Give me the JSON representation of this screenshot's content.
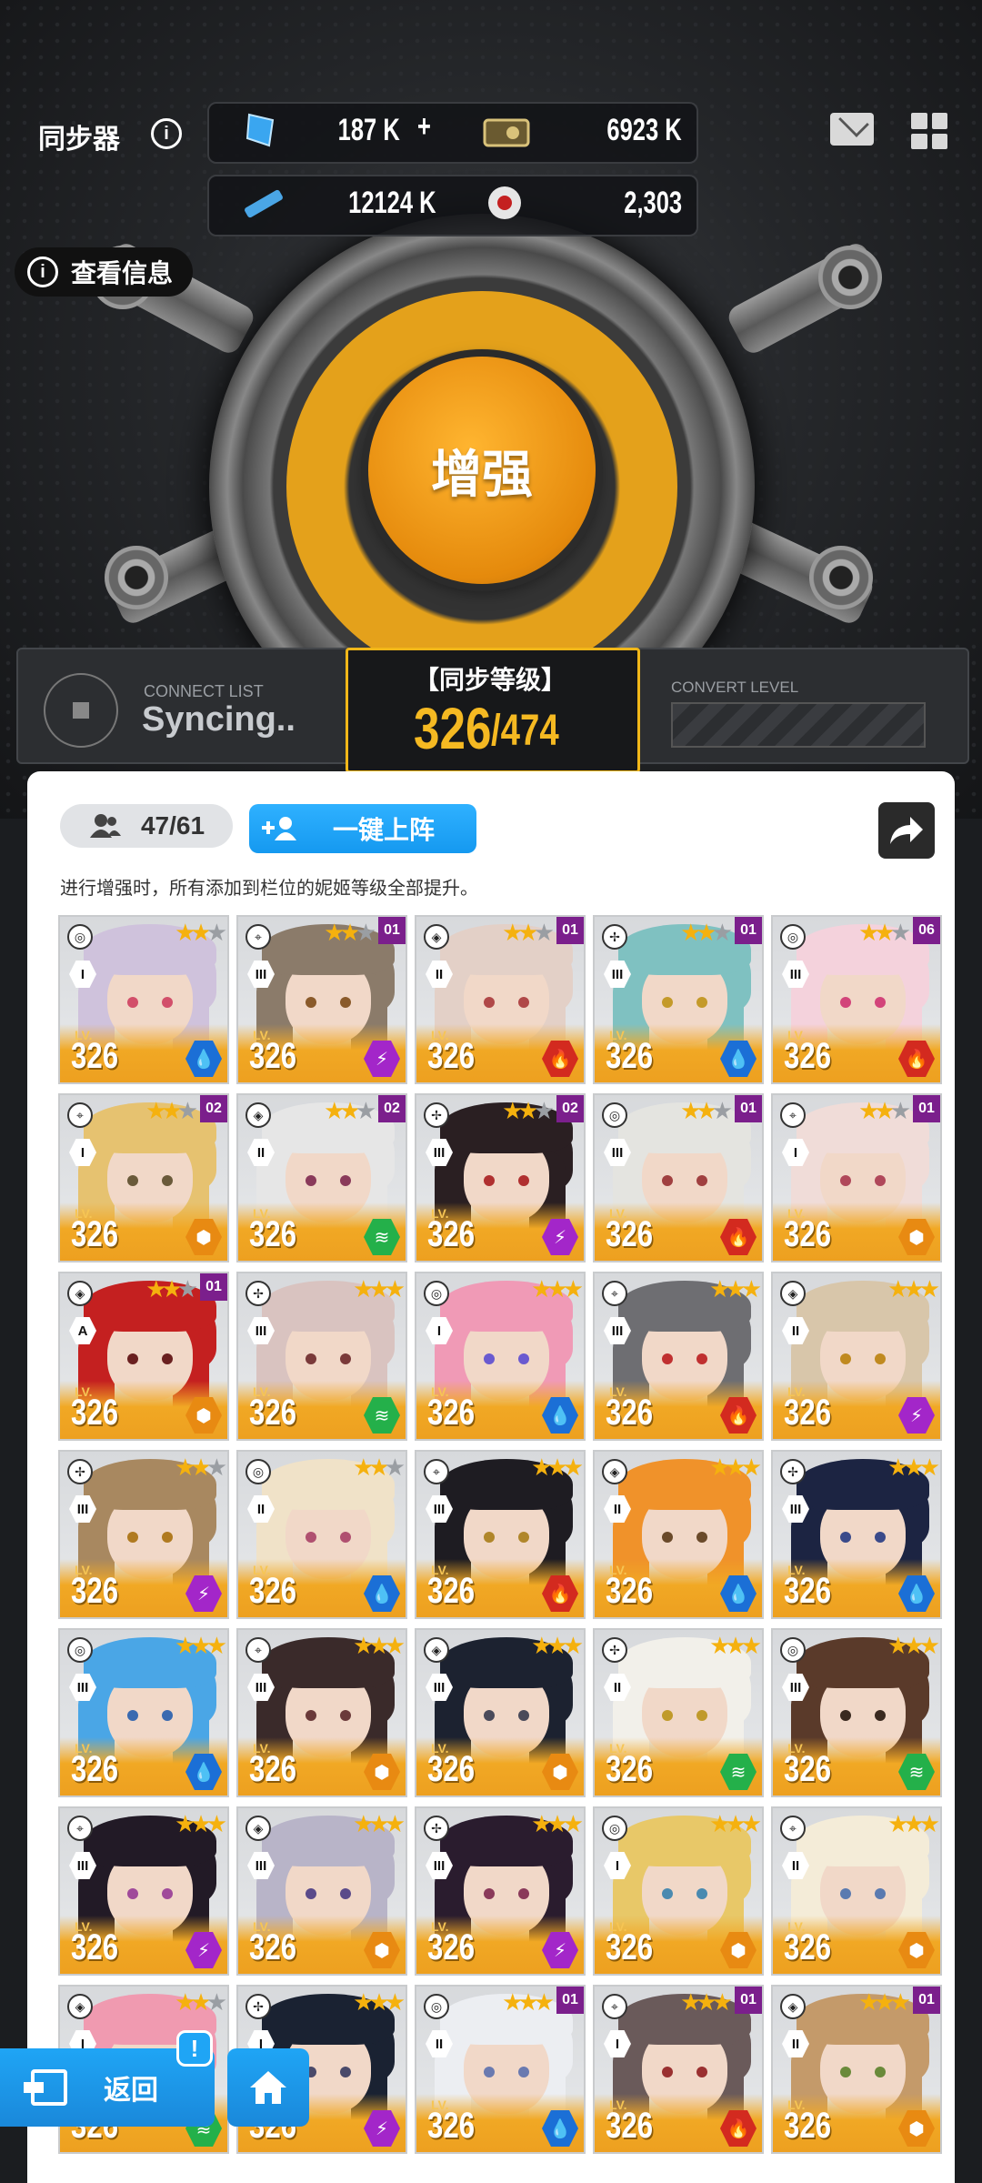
{
  "header": {
    "title": "同步器",
    "info_glyph": "i",
    "view_info_label": "查看信息"
  },
  "resources": {
    "gems": "187 K",
    "plus": "+",
    "credits": "6923 K",
    "battle_data": "12124 K",
    "core_dust": "2,303"
  },
  "enhance_label": "增强",
  "status": {
    "connect_label": "CONNECT LIST",
    "syncing": "Syncing..",
    "level_title": "【同步等级】",
    "level_current": "326",
    "level_max": "/474",
    "convert_label": "CONVERT LEVEL"
  },
  "panel": {
    "count": "47/61",
    "deploy_label": "一键上阵",
    "hint": "进行增强时，所有添加到栏位的妮姬等级全部提升。",
    "lv_text": "LV."
  },
  "nav": {
    "back_label": "返回",
    "alert": "!"
  },
  "colors": {
    "accent_orange": "#f1a824",
    "accent_blue": "#1fa5f5",
    "core_purple": "#7b1f8c",
    "water": "#1b6fd6",
    "fire": "#d32a1f",
    "electric": "#a326c9",
    "iron": "#e88a12",
    "wind": "#24b04a"
  },
  "cards": [
    {
      "level": "326",
      "burst": "I",
      "stars": "★★",
      "core": "",
      "elem": "water",
      "hair": "#cfc2dc",
      "eye": "#d24f6a"
    },
    {
      "level": "326",
      "burst": "III",
      "stars": "★★",
      "core": "01",
      "elem": "electric",
      "hair": "#8b7b6a",
      "eye": "#8a5a2a"
    },
    {
      "level": "326",
      "burst": "II",
      "stars": "★★",
      "core": "01",
      "elem": "fire",
      "hair": "#e3d0c7",
      "eye": "#b04848"
    },
    {
      "level": "326",
      "burst": "III",
      "stars": "★★",
      "core": "01",
      "elem": "water",
      "hair": "#7fc1c1",
      "eye": "#c49a2a"
    },
    {
      "level": "326",
      "burst": "III",
      "stars": "★★",
      "core": "06",
      "elem": "fire",
      "hair": "#f4d2dc",
      "eye": "#d2447a"
    },
    {
      "level": "326",
      "burst": "I",
      "stars": "★★",
      "core": "02",
      "elem": "iron",
      "hair": "#e6c270",
      "eye": "#6a5a3a"
    },
    {
      "level": "326",
      "burst": "II",
      "stars": "★★",
      "core": "02",
      "elem": "wind",
      "hair": "#e6e6e6",
      "eye": "#8a3a5a"
    },
    {
      "level": "326",
      "burst": "III",
      "stars": "★★",
      "core": "02",
      "elem": "electric",
      "hair": "#2a1f22",
      "eye": "#b03030"
    },
    {
      "level": "326",
      "burst": "III",
      "stars": "★★",
      "core": "01",
      "elem": "fire",
      "hair": "#e4e4e0",
      "eye": "#a04040"
    },
    {
      "level": "326",
      "burst": "I",
      "stars": "★★",
      "core": "01",
      "elem": "iron",
      "hair": "#f0dcd8",
      "eye": "#b0485a"
    },
    {
      "level": "326",
      "burst": "A",
      "stars": "★★",
      "core": "01",
      "elem": "iron",
      "hair": "#c42020",
      "eye": "#6a2020"
    },
    {
      "level": "326",
      "burst": "III",
      "stars": "★★★",
      "core": "",
      "elem": "wind",
      "hair": "#d9c3c0",
      "eye": "#7a3a3a"
    },
    {
      "level": "326",
      "burst": "I",
      "stars": "★★★",
      "core": "",
      "elem": "water",
      "hair": "#f09ab6",
      "eye": "#6a5ad0"
    },
    {
      "level": "326",
      "burst": "III",
      "stars": "★★★",
      "core": "",
      "elem": "fire",
      "hair": "#6e6e72",
      "eye": "#c03030"
    },
    {
      "level": "326",
      "burst": "II",
      "stars": "★★★",
      "core": "",
      "elem": "electric",
      "hair": "#d8c6aa",
      "eye": "#c08a20"
    },
    {
      "level": "326",
      "burst": "III",
      "stars": "★★",
      "core": "",
      "elem": "electric",
      "hair": "#a88860",
      "eye": "#b07a20"
    },
    {
      "level": "326",
      "burst": "II",
      "stars": "★★",
      "core": "",
      "elem": "water",
      "hair": "#f0e2c8",
      "eye": "#b05070"
    },
    {
      "level": "326",
      "burst": "III",
      "stars": "★★★",
      "core": "",
      "elem": "fire",
      "hair": "#1e1c22",
      "eye": "#b0862a"
    },
    {
      "level": "326",
      "burst": "II",
      "stars": "★★★",
      "core": "",
      "elem": "water",
      "hair": "#f0922a",
      "eye": "#6a4a2a"
    },
    {
      "level": "326",
      "burst": "III",
      "stars": "★★★",
      "core": "",
      "elem": "water",
      "hair": "#1c2442",
      "eye": "#3a4a8a"
    },
    {
      "level": "326",
      "burst": "III",
      "stars": "★★★",
      "core": "",
      "elem": "water",
      "hair": "#4aa6e6",
      "eye": "#3a6ab0"
    },
    {
      "level": "326",
      "burst": "III",
      "stars": "★★★",
      "core": "",
      "elem": "iron",
      "hair": "#3a2a2a",
      "eye": "#6a3a3a"
    },
    {
      "level": "326",
      "burst": "III",
      "stars": "★★★",
      "core": "",
      "elem": "iron",
      "hair": "#1c2230",
      "eye": "#4a4a5a"
    },
    {
      "level": "326",
      "burst": "II",
      "stars": "★★★",
      "core": "",
      "elem": "wind",
      "hair": "#f2f0ea",
      "eye": "#c09a2a"
    },
    {
      "level": "326",
      "burst": "III",
      "stars": "★★★",
      "core": "",
      "elem": "wind",
      "hair": "#5a3a2a",
      "eye": "#3a2a20"
    },
    {
      "level": "326",
      "burst": "III",
      "stars": "★★★",
      "core": "",
      "elem": "electric",
      "hair": "#221a26",
      "eye": "#a04a9a"
    },
    {
      "level": "326",
      "burst": "III",
      "stars": "★★★",
      "core": "",
      "elem": "iron",
      "hair": "#b8b4c8",
      "eye": "#5a4a8a"
    },
    {
      "level": "326",
      "burst": "III",
      "stars": "★★★",
      "core": "",
      "elem": "electric",
      "hair": "#2a1c2e",
      "eye": "#8a3a5a"
    },
    {
      "level": "326",
      "burst": "I",
      "stars": "★★★",
      "core": "",
      "elem": "iron",
      "hair": "#e8c868",
      "eye": "#4a8ab0"
    },
    {
      "level": "326",
      "burst": "II",
      "stars": "★★★",
      "core": "",
      "elem": "iron",
      "hair": "#f4ecd8",
      "eye": "#5a7ab0"
    },
    {
      "level": "326",
      "burst": "I",
      "stars": "★★",
      "core": "",
      "elem": "wind",
      "hair": "#f09ab0",
      "eye": "#8a3a4a"
    },
    {
      "level": "326",
      "burst": "I",
      "stars": "★★★",
      "core": "",
      "elem": "electric",
      "hair": "#1a2232",
      "eye": "#4a4a6a"
    },
    {
      "level": "326",
      "burst": "II",
      "stars": "★★★",
      "core": "01",
      "elem": "water",
      "hair": "#eceef2",
      "eye": "#6a7ab0"
    },
    {
      "level": "326",
      "burst": "I",
      "stars": "★★★",
      "core": "01",
      "elem": "fire",
      "hair": "#6a5a5a",
      "eye": "#9a3030"
    },
    {
      "level": "326",
      "burst": "II",
      "stars": "★★★",
      "core": "01",
      "elem": "iron",
      "hair": "#c49a6a",
      "eye": "#6a8a3a"
    }
  ]
}
